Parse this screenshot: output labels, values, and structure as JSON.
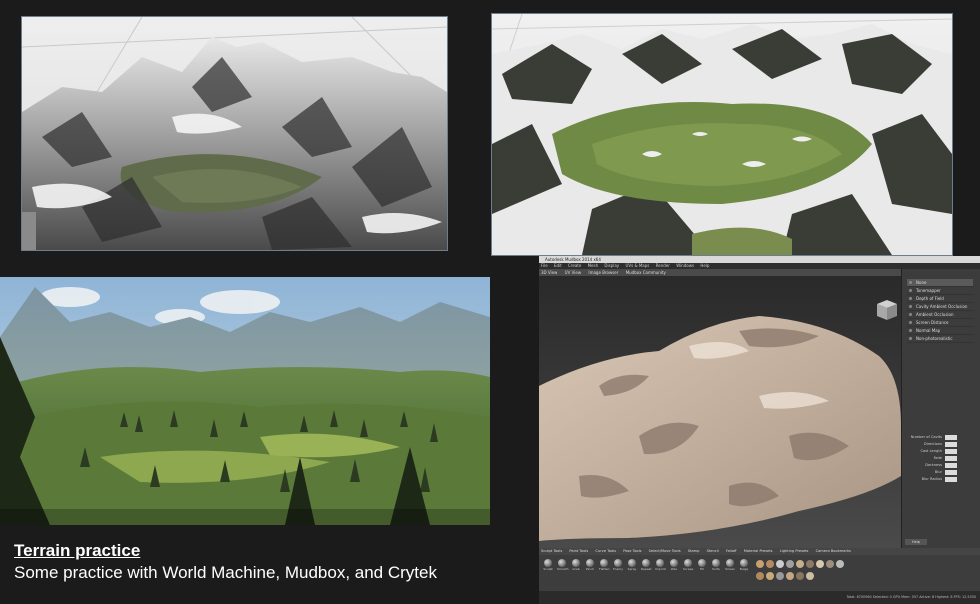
{
  "caption": {
    "title": "Terrain practice",
    "subtitle": "Some practice with World Machine, Mudbox, and Crytek"
  },
  "mudbox": {
    "window_title": "Autodesk Mudbox 2014 x64",
    "menu": [
      "File",
      "Edit",
      "Create",
      "Mesh",
      "Display",
      "UVs & Maps",
      "Render",
      "Windows",
      "Help"
    ],
    "tabs": [
      "3D View",
      "UV View",
      "Image Browser",
      "Mudbox Community"
    ],
    "viewport_filters": {
      "header": "None",
      "items": [
        "Tonemapper",
        "Depth of Field",
        "Cavity Ambient Occlusion",
        "Ambient Occlusion",
        "Screen Distance",
        "Normal Map",
        "Non-photorealistic"
      ]
    },
    "properties": [
      "Number of Cavits",
      "Directions",
      "Cast Length",
      "Fade",
      "Darkness",
      "Blur",
      "Blur Radius"
    ],
    "help_label": "Help",
    "shelf_tabs": [
      "Sculpt Tools",
      "Paint Tools",
      "Curve Tools",
      "Pose Tools",
      "Select/Move Tools",
      "Stamp",
      "Stencil",
      "Falloff",
      "Material Presets",
      "Lighting Presets",
      "Camera Bookmarks"
    ],
    "tools": [
      "Sculpt",
      "Smooth",
      "Grab",
      "Pinch",
      "Flatten",
      "Foamy",
      "Spray",
      "Repeat",
      "Imprint",
      "Wax",
      "Scrape",
      "Fill",
      "Knife",
      "Smear",
      "Bulge"
    ],
    "status": "Total: 8700960  Selected: 0  GPU Mem: 557  Active: 8  Highest: 8  FPS: 12.5330"
  }
}
